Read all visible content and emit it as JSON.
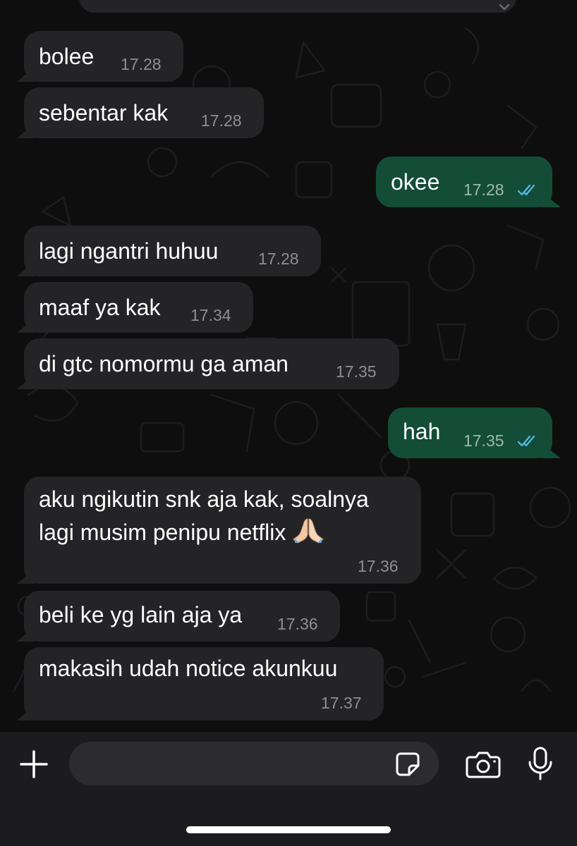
{
  "messages": [
    {
      "direction": "in",
      "text": "bolee",
      "time": "17.28"
    },
    {
      "direction": "in",
      "text": "sebentar kak",
      "time": "17.28"
    },
    {
      "direction": "out",
      "text": "okee",
      "time": "17.28",
      "status": "read"
    },
    {
      "direction": "in",
      "text": "lagi ngantri huhuu",
      "time": "17.28"
    },
    {
      "direction": "in",
      "text": "maaf ya kak",
      "time": "17.34"
    },
    {
      "direction": "in",
      "text": "di gtc nomormu ga aman",
      "time": "17.35"
    },
    {
      "direction": "out",
      "text": "hah",
      "time": "17.35",
      "status": "read"
    },
    {
      "direction": "in",
      "line1": "aku ngikutin snk aja kak, soalnya",
      "line2": "lagi musim penipu netflix",
      "emoji": "folded-hands",
      "time": "17.36"
    },
    {
      "direction": "in",
      "text": "beli ke yg lain aja ya",
      "time": "17.36"
    },
    {
      "direction": "in",
      "text": "makasih udah notice akunkuu",
      "time": "17.37"
    }
  ],
  "composer": {
    "input_value": "",
    "icons": [
      "plus-icon",
      "sticker-icon",
      "camera-icon",
      "microphone-icon"
    ]
  },
  "colors": {
    "background": "#0e0e0e",
    "incoming_bubble": "#242426",
    "outgoing_bubble": "#134d37",
    "read_ticks": "#53bdeb",
    "timestamp": "#8e8e93",
    "composer_bar": "#1c1c1e"
  }
}
